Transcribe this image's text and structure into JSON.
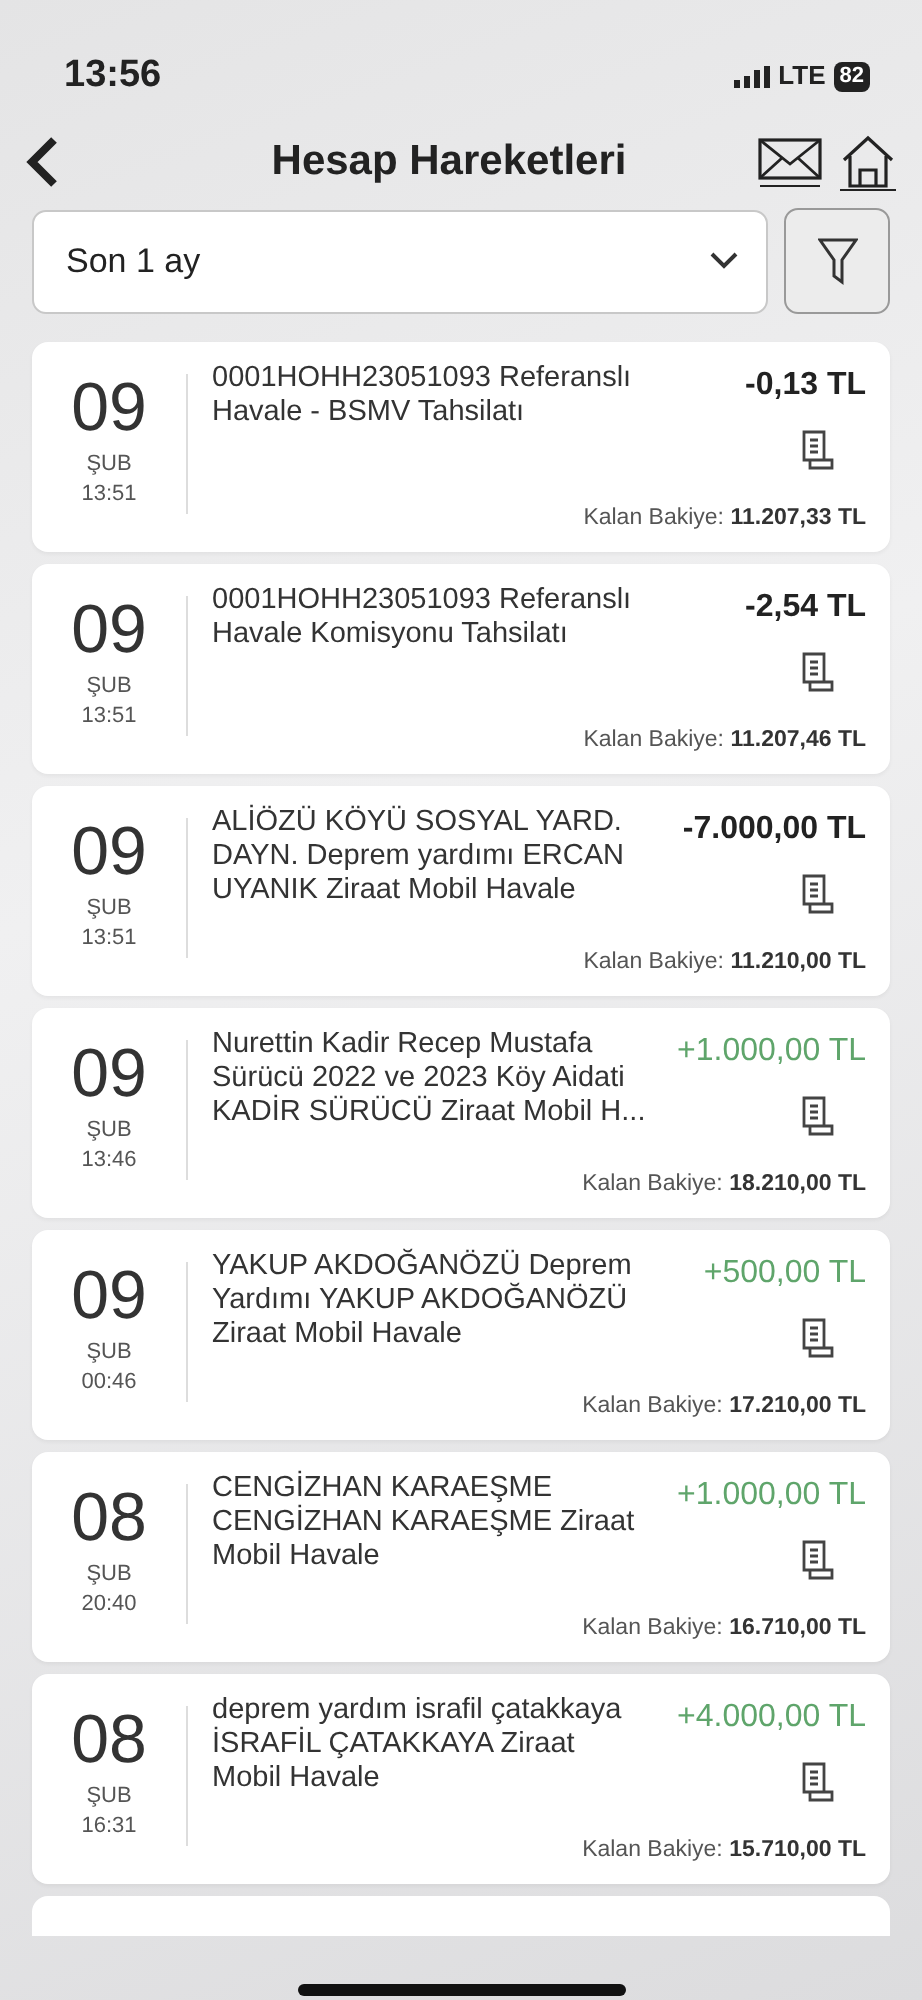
{
  "status_bar": {
    "time": "13:56",
    "network": "LTE",
    "battery": "82"
  },
  "header": {
    "title": "Hesap Hareketleri"
  },
  "period_select": {
    "value": "Son 1 ay"
  },
  "transactions": [
    {
      "day": "09",
      "month": "ŞUB",
      "time": "13:51",
      "description": "0001HOHH23051093 Referanslı\nHavale - BSMV Tahsilatı",
      "amount": "-0,13 TL",
      "kind": "debit",
      "balance_label": "Kalan Bakiye:",
      "balance": "11.207,33 TL"
    },
    {
      "day": "09",
      "month": "ŞUB",
      "time": "13:51",
      "description": "0001HOHH23051093 Referanslı\nHavale Komisyonu Tahsilatı",
      "amount": "-2,54 TL",
      "kind": "debit",
      "balance_label": "Kalan Bakiye:",
      "balance": "11.207,46 TL"
    },
    {
      "day": "09",
      "month": "ŞUB",
      "time": "13:51",
      "description": "ALİÖZÜ KÖYÜ SOSYAL YARD.\nDAYN. Deprem yardımı ERCAN\nUYANIK Ziraat Mobil Havale",
      "amount": "-7.000,00 TL",
      "kind": "debit",
      "balance_label": "Kalan Bakiye:",
      "balance": "11.210,00 TL"
    },
    {
      "day": "09",
      "month": "ŞUB",
      "time": "13:46",
      "description": "Nurettin Kadir Recep Mustafa\nSürücü 2022 ve 2023 Köy Aidati\nKADİR SÜRÜCÜ Ziraat Mobil H...",
      "amount": "+1.000,00 TL",
      "kind": "credit",
      "balance_label": "Kalan Bakiye:",
      "balance": "18.210,00 TL"
    },
    {
      "day": "09",
      "month": "ŞUB",
      "time": "00:46",
      "description": "YAKUP AKDOĞANÖZÜ Deprem\nYardımı YAKUP AKDOĞANÖZÜ\nZiraat Mobil Havale",
      "amount": "+500,00 TL",
      "kind": "credit",
      "balance_label": "Kalan Bakiye:",
      "balance": "17.210,00 TL"
    },
    {
      "day": "08",
      "month": "ŞUB",
      "time": "20:40",
      "description": "CENGİZHAN KARAEŞME\nCENGİZHAN KARAEŞME Ziraat\nMobil Havale",
      "amount": "+1.000,00 TL",
      "kind": "credit",
      "balance_label": "Kalan Bakiye:",
      "balance": "16.710,00 TL"
    },
    {
      "day": "08",
      "month": "ŞUB",
      "time": "16:31",
      "description": "deprem yardım israfil çatakkaya\nİSRAFİL ÇATAKKAYA Ziraat\nMobil Havale",
      "amount": "+4.000,00 TL",
      "kind": "credit",
      "balance_label": "Kalan Bakiye:",
      "balance": "15.710,00 TL"
    }
  ]
}
